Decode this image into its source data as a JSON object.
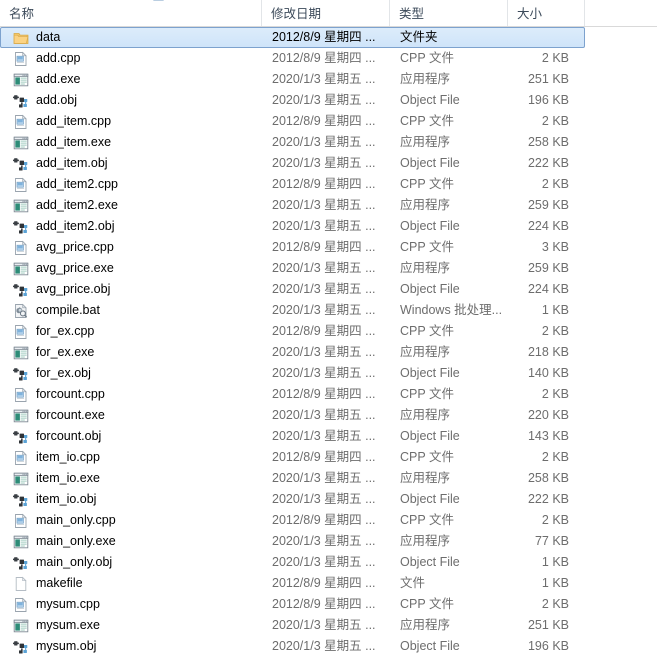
{
  "window": {
    "title": "File Explorer List View"
  },
  "columns": [
    {
      "key": "name",
      "label": "名称"
    },
    {
      "key": "date",
      "label": "修改日期"
    },
    {
      "key": "type",
      "label": "类型"
    },
    {
      "key": "size",
      "label": "大小"
    }
  ],
  "sort": {
    "column": "名称",
    "direction": "ascending",
    "indicator_icon": "sort-ascending-arrow-icon"
  },
  "files": [
    {
      "name": "data",
      "icon": "folder-icon",
      "date": "2012/8/9 星期四 ...",
      "type": "文件夹",
      "size": "",
      "selected": true
    },
    {
      "name": "add.cpp",
      "icon": "cpp-file-icon",
      "date": "2012/8/9 星期四 ...",
      "type": "CPP 文件",
      "size": "2 KB",
      "selected": false
    },
    {
      "name": "add.exe",
      "icon": "application-icon",
      "date": "2020/1/3 星期五 ...",
      "type": "应用程序",
      "size": "251 KB",
      "selected": false
    },
    {
      "name": "add.obj",
      "icon": "object-file-icon",
      "date": "2020/1/3 星期五 ...",
      "type": "Object File",
      "size": "196 KB",
      "selected": false
    },
    {
      "name": "add_item.cpp",
      "icon": "cpp-file-icon",
      "date": "2012/8/9 星期四 ...",
      "type": "CPP 文件",
      "size": "2 KB",
      "selected": false
    },
    {
      "name": "add_item.exe",
      "icon": "application-icon",
      "date": "2020/1/3 星期五 ...",
      "type": "应用程序",
      "size": "258 KB",
      "selected": false
    },
    {
      "name": "add_item.obj",
      "icon": "object-file-icon",
      "date": "2020/1/3 星期五 ...",
      "type": "Object File",
      "size": "222 KB",
      "selected": false
    },
    {
      "name": "add_item2.cpp",
      "icon": "cpp-file-icon",
      "date": "2012/8/9 星期四 ...",
      "type": "CPP 文件",
      "size": "2 KB",
      "selected": false
    },
    {
      "name": "add_item2.exe",
      "icon": "application-icon",
      "date": "2020/1/3 星期五 ...",
      "type": "应用程序",
      "size": "259 KB",
      "selected": false
    },
    {
      "name": "add_item2.obj",
      "icon": "object-file-icon",
      "date": "2020/1/3 星期五 ...",
      "type": "Object File",
      "size": "224 KB",
      "selected": false
    },
    {
      "name": "avg_price.cpp",
      "icon": "cpp-file-icon",
      "date": "2012/8/9 星期四 ...",
      "type": "CPP 文件",
      "size": "3 KB",
      "selected": false
    },
    {
      "name": "avg_price.exe",
      "icon": "application-icon",
      "date": "2020/1/3 星期五 ...",
      "type": "应用程序",
      "size": "259 KB",
      "selected": false
    },
    {
      "name": "avg_price.obj",
      "icon": "object-file-icon",
      "date": "2020/1/3 星期五 ...",
      "type": "Object File",
      "size": "224 KB",
      "selected": false
    },
    {
      "name": "compile.bat",
      "icon": "batch-file-icon",
      "date": "2020/1/3 星期五 ...",
      "type": "Windows 批处理...",
      "size": "1 KB",
      "selected": false
    },
    {
      "name": "for_ex.cpp",
      "icon": "cpp-file-icon",
      "date": "2012/8/9 星期四 ...",
      "type": "CPP 文件",
      "size": "2 KB",
      "selected": false
    },
    {
      "name": "for_ex.exe",
      "icon": "application-icon",
      "date": "2020/1/3 星期五 ...",
      "type": "应用程序",
      "size": "218 KB",
      "selected": false
    },
    {
      "name": "for_ex.obj",
      "icon": "object-file-icon",
      "date": "2020/1/3 星期五 ...",
      "type": "Object File",
      "size": "140 KB",
      "selected": false
    },
    {
      "name": "forcount.cpp",
      "icon": "cpp-file-icon",
      "date": "2012/8/9 星期四 ...",
      "type": "CPP 文件",
      "size": "2 KB",
      "selected": false
    },
    {
      "name": "forcount.exe",
      "icon": "application-icon",
      "date": "2020/1/3 星期五 ...",
      "type": "应用程序",
      "size": "220 KB",
      "selected": false
    },
    {
      "name": "forcount.obj",
      "icon": "object-file-icon",
      "date": "2020/1/3 星期五 ...",
      "type": "Object File",
      "size": "143 KB",
      "selected": false
    },
    {
      "name": "item_io.cpp",
      "icon": "cpp-file-icon",
      "date": "2012/8/9 星期四 ...",
      "type": "CPP 文件",
      "size": "2 KB",
      "selected": false
    },
    {
      "name": "item_io.exe",
      "icon": "application-icon",
      "date": "2020/1/3 星期五 ...",
      "type": "应用程序",
      "size": "258 KB",
      "selected": false
    },
    {
      "name": "item_io.obj",
      "icon": "object-file-icon",
      "date": "2020/1/3 星期五 ...",
      "type": "Object File",
      "size": "222 KB",
      "selected": false
    },
    {
      "name": "main_only.cpp",
      "icon": "cpp-file-icon",
      "date": "2012/8/9 星期四 ...",
      "type": "CPP 文件",
      "size": "2 KB",
      "selected": false
    },
    {
      "name": "main_only.exe",
      "icon": "application-icon",
      "date": "2020/1/3 星期五 ...",
      "type": "应用程序",
      "size": "77 KB",
      "selected": false
    },
    {
      "name": "main_only.obj",
      "icon": "object-file-icon",
      "date": "2020/1/3 星期五 ...",
      "type": "Object File",
      "size": "1 KB",
      "selected": false
    },
    {
      "name": "makefile",
      "icon": "generic-file-icon",
      "date": "2012/8/9 星期四 ...",
      "type": "文件",
      "size": "1 KB",
      "selected": false
    },
    {
      "name": "mysum.cpp",
      "icon": "cpp-file-icon",
      "date": "2012/8/9 星期四 ...",
      "type": "CPP 文件",
      "size": "2 KB",
      "selected": false
    },
    {
      "name": "mysum.exe",
      "icon": "application-icon",
      "date": "2020/1/3 星期五 ...",
      "type": "应用程序",
      "size": "251 KB",
      "selected": false
    },
    {
      "name": "mysum.obj",
      "icon": "object-file-icon",
      "date": "2020/1/3 星期五 ...",
      "type": "Object File",
      "size": "196 KB",
      "selected": false
    }
  ],
  "colors": {
    "selection_fill": "#cfe4f9",
    "selection_border": "#7da2ce",
    "header_text": "#3c4a5a",
    "secondary_text": "#6d6d6d",
    "divider": "#e2e5e8",
    "folder": "#fcd88b"
  }
}
